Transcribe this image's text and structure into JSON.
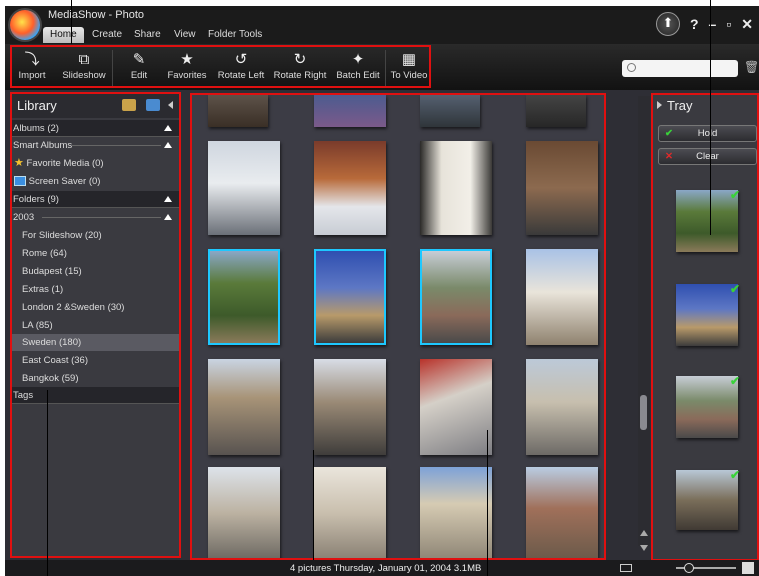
{
  "app": {
    "title": "MediaShow - Photo"
  },
  "menu": [
    "Home",
    "Create",
    "Share",
    "View",
    "Folder Tools"
  ],
  "toolbar": {
    "tools": [
      {
        "label": "Import",
        "icon": "import-icon"
      },
      {
        "label": "Slideshow",
        "icon": "slideshow-icon"
      },
      {
        "label": "Edit",
        "icon": "edit-icon"
      },
      {
        "label": "Favorites",
        "icon": "star-icon"
      },
      {
        "label": "Rotate Left",
        "icon": "rotate-left-icon"
      },
      {
        "label": "Rotate Right",
        "icon": "rotate-right-icon"
      },
      {
        "label": "Batch Edit",
        "icon": "batch-edit-icon"
      },
      {
        "label": "To Video",
        "icon": "to-video-icon"
      }
    ]
  },
  "window": {
    "help": "?"
  },
  "library": {
    "title": "Library",
    "albums": "Albums (2)",
    "smart_albums": "Smart Albums",
    "favorite_media": "Favorite Media (0)",
    "screen_saver": "Screen Saver (0)",
    "folders": "Folders (9)",
    "year": "2003",
    "folder_items": [
      "For Slideshow (20)",
      "Rome (64)",
      "Budapest (15)",
      "Extras (1)",
      "London 2 &Sweden (30)",
      "LA (85)",
      "Sweden (180)",
      "East Coast (36)",
      "Bangkok (59)"
    ],
    "tags": "Tags"
  },
  "tray": {
    "title": "Tray",
    "hold_label": "Hold",
    "clear_label": "Clear"
  },
  "status": {
    "text": "4 pictures  Thursday, January 01, 2004  3.1MB"
  },
  "colors": {
    "highlight": "#1ec8ff",
    "annotation_red": "#e01010",
    "check_green": "#39d239"
  }
}
